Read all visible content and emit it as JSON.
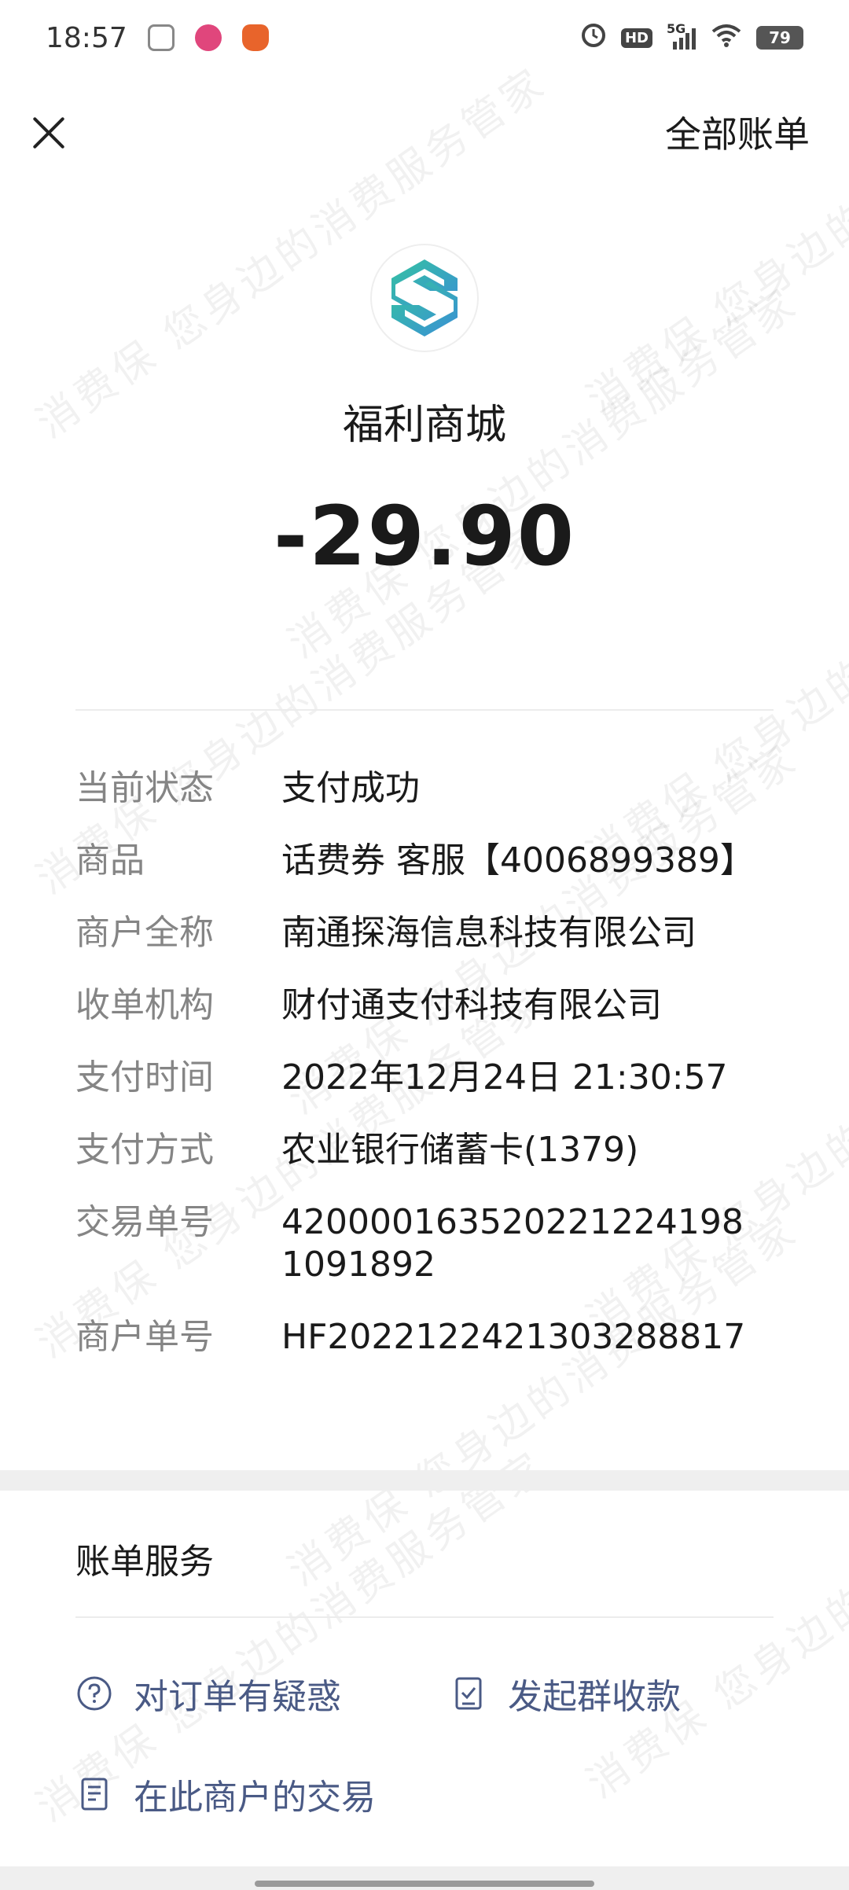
{
  "status_bar": {
    "time": "18:57",
    "network": "5G",
    "hd": "HD",
    "battery": "79"
  },
  "nav": {
    "all_bills_label": "全部账单"
  },
  "merchant": {
    "name": "福利商城",
    "amount": "-29.90",
    "logo_colors": [
      "#2cb7a8",
      "#3f8fd8"
    ]
  },
  "details": [
    {
      "label": "当前状态",
      "value": "支付成功"
    },
    {
      "label": "商品",
      "value": "话费券 客服【4006899389】"
    },
    {
      "label": "商户全称",
      "value": "南通探海信息科技有限公司"
    },
    {
      "label": "收单机构",
      "value": "财付通支付科技有限公司"
    },
    {
      "label": "支付时间",
      "value": "2022年12月24日 21:30:57"
    },
    {
      "label": "支付方式",
      "value": "农业银行储蓄卡(1379)"
    },
    {
      "label": "交易单号",
      "value": "4200001635202212241981091892"
    },
    {
      "label": "商户单号",
      "value": "HF2022122421303288817"
    }
  ],
  "services": {
    "title": "账单服务",
    "order_question": "对订单有疑惑",
    "group_collect": "发起群收款",
    "merchant_transactions": "在此商户的交易"
  },
  "watermark": {
    "text": "消费保 您身边的消费服务管家"
  },
  "colors": {
    "service_link": "#4a5a85",
    "label_gray": "#858585"
  }
}
